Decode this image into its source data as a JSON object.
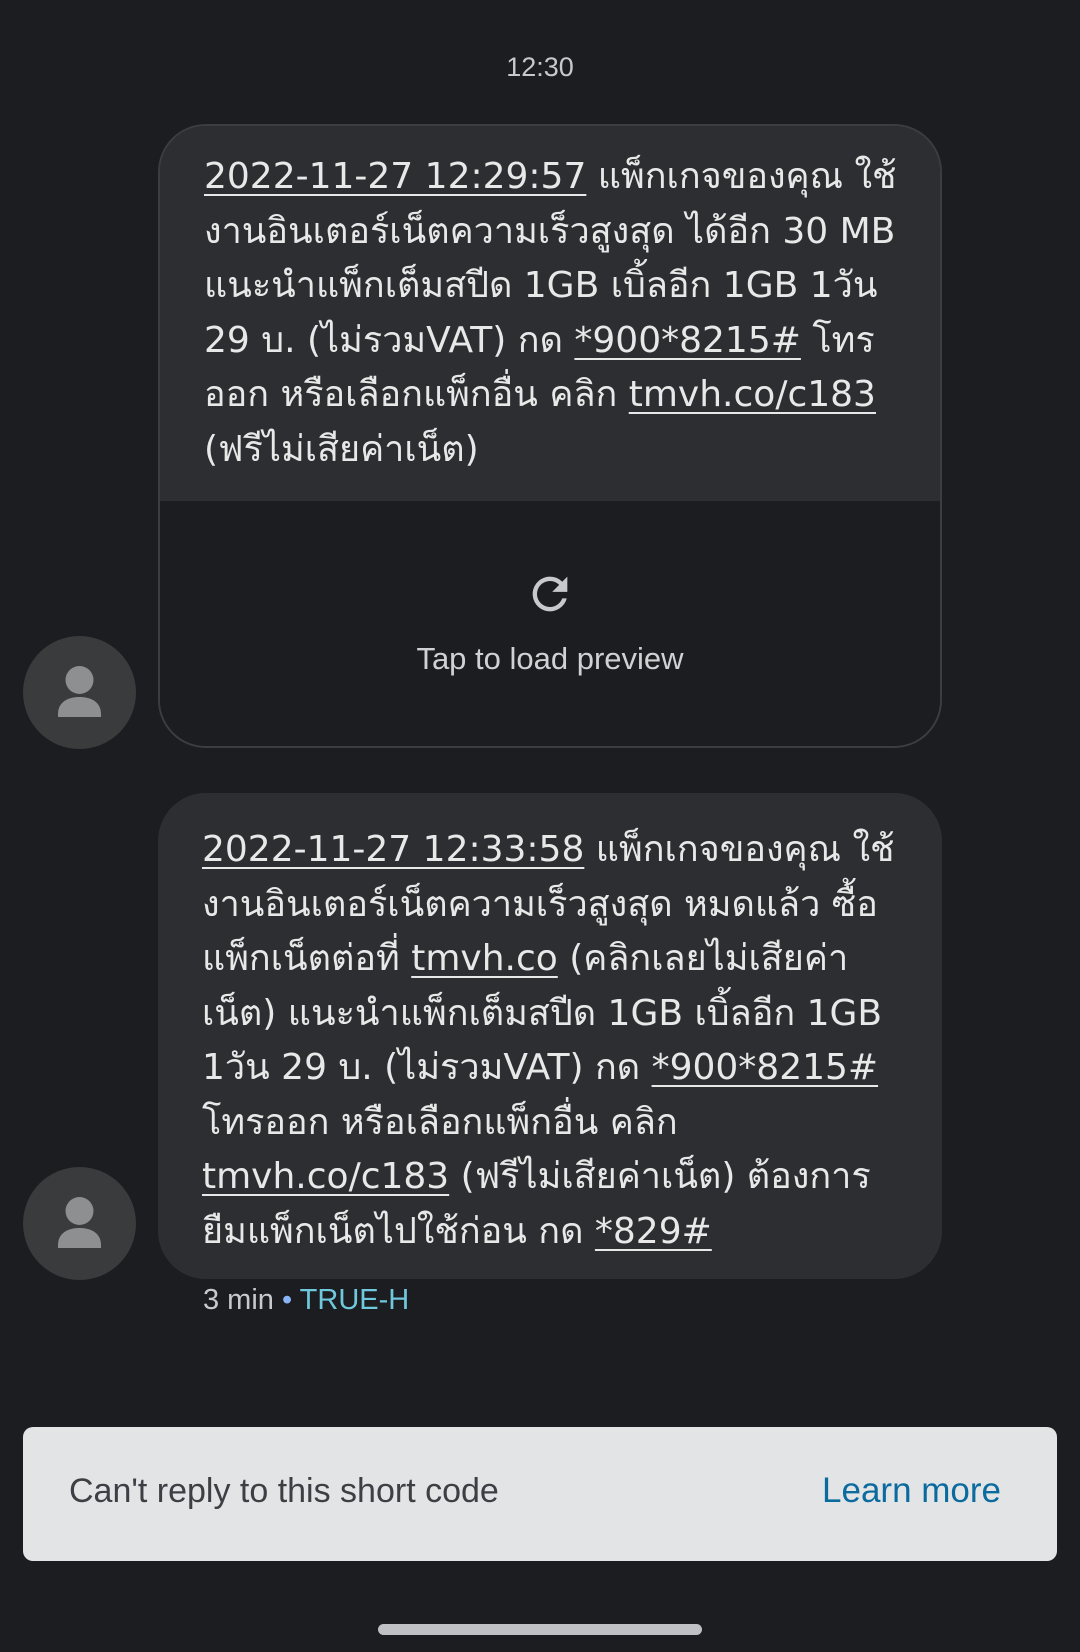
{
  "header": {
    "time": "12:30"
  },
  "messages": [
    {
      "segments": [
        {
          "text": "2022-11-27 12:29:57",
          "link": true
        },
        {
          "text": " แพ็กเกจของคุณ ใช้งานอินเตอร์เน็ตความเร็วสูงสุด ได้อีก 30 MB แนะนำแพ็กเต็มสปีด 1GB เบิ้ลอีก 1GB 1วัน 29 บ. (ไม่รวมVAT) กด ",
          "link": false
        },
        {
          "text": "*900*8215#",
          "link": true
        },
        {
          "text": " โทรออก หรือเลือกแพ็กอื่น คลิก ",
          "link": false
        },
        {
          "text": "tmvh.co/c183",
          "link": true
        },
        {
          "text": " (ฟรีไม่เสียค่าเน็ต)",
          "link": false
        }
      ],
      "preview_label": "Tap to load preview",
      "preview_icon": "refresh-icon"
    },
    {
      "segments": [
        {
          "text": "2022-11-27 12:33:58",
          "link": true
        },
        {
          "text": " แพ็กเกจของคุณ ใช้งานอินเตอร์เน็ตความเร็วสูงสุด หมดแล้ว ซื้อแพ็กเน็ตต่อที่ ",
          "link": false
        },
        {
          "text": "tmvh.co",
          "link": true
        },
        {
          "text": " (คลิกเลยไม่เสียค่าเน็ต) แนะนำแพ็กเต็มสปีด 1GB เบิ้ลอีก 1GB 1วัน 29 บ. (ไม่รวมVAT) กด ",
          "link": false
        },
        {
          "text": "*900*8215#",
          "link": true
        },
        {
          "text": " โทรออก หรือเลือกแพ็กอื่น คลิก ",
          "link": false
        },
        {
          "text": "tmvh.co/c183",
          "link": true
        },
        {
          "text": " (ฟรีไม่เสียค่าเน็ต) ต้องการยืมแพ็กเน็ตไปใช้ก่อน กด ",
          "link": false
        },
        {
          "text": "*829#",
          "link": true
        }
      ],
      "meta": {
        "age": "3 min",
        "separator": " • ",
        "sender": "TRUE-H"
      }
    }
  ],
  "reply_bar": {
    "text": "Can't reply to this short code",
    "action": "Learn more"
  },
  "colors": {
    "background": "#1b1d20",
    "bubble": "#2c2e31",
    "avatar": "#3a3b3d",
    "sender": "#6fc8dc",
    "reply_bar": "#e3e4e6",
    "learn_more": "#0b6b9e"
  }
}
